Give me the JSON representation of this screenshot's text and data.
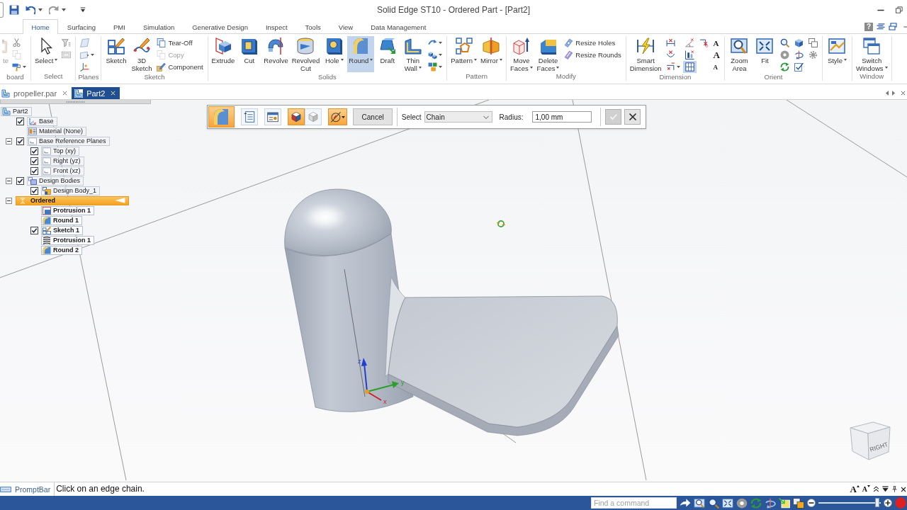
{
  "window": {
    "title": "Solid Edge ST10 - Ordered Part - [Part2]"
  },
  "ribbon_tabs": [
    {
      "label": "Home",
      "selected": true
    },
    {
      "label": "Surfacing",
      "selected": false
    },
    {
      "label": "PMI",
      "selected": false
    },
    {
      "label": "Simulation",
      "selected": false
    },
    {
      "label": "Generative Design",
      "selected": false
    },
    {
      "label": "Inspect",
      "selected": false
    },
    {
      "label": "Tools",
      "selected": false
    },
    {
      "label": "View",
      "selected": false
    },
    {
      "label": "Data Management",
      "selected": false
    }
  ],
  "help_button": {
    "label": "?"
  },
  "ribbon": [
    {
      "label": "board",
      "items": [
        {
          "kind": "large",
          "label": "te",
          "selected": false,
          "disabled": true
        },
        {
          "kind": "column",
          "buttons": [
            {
              "selected": false
            },
            {
              "selected": false,
              "disabled": true
            },
            {
              "selected": false,
              "dropdown": true
            }
          ]
        }
      ]
    },
    {
      "label": "Select",
      "items": [
        {
          "kind": "large",
          "label": "Select",
          "selected": false,
          "dropdown": true
        },
        {
          "kind": "column",
          "buttons": [
            {
              "selected": false
            },
            {
              "selected": false
            }
          ]
        }
      ]
    },
    {
      "label": "Planes",
      "items": [
        {
          "kind": "column",
          "buttons": [
            {
              "selected": false
            },
            {
              "selected": false,
              "dropdown": true
            },
            {
              "selected": false
            }
          ]
        }
      ]
    },
    {
      "label": "Sketch",
      "items": [
        {
          "kind": "large",
          "label": "Sketch",
          "selected": false
        },
        {
          "kind": "large",
          "label": "3D Sketch",
          "selected": false
        },
        {
          "kind": "column",
          "buttons": [
            {
              "label": "Tear-Off",
              "selected": false
            },
            {
              "label": "Copy",
              "selected": false,
              "disabled": true
            },
            {
              "label": "Component",
              "selected": false
            }
          ]
        }
      ]
    },
    {
      "label": "Solids",
      "items": [
        {
          "kind": "large",
          "label": "Extrude",
          "selected": false
        },
        {
          "kind": "large",
          "label": "Cut",
          "selected": false
        },
        {
          "kind": "large",
          "label": "Revolve",
          "selected": false
        },
        {
          "kind": "large",
          "label": "Revolved Cut",
          "selected": false
        },
        {
          "kind": "large",
          "label": "Hole",
          "selected": false,
          "dropdown": true
        },
        {
          "kind": "large",
          "label": "Round",
          "selected": true,
          "dropdown": true
        },
        {
          "kind": "large",
          "label": "Draft",
          "selected": false
        },
        {
          "kind": "large",
          "label": "Thin Wall",
          "selected": false,
          "dropdown": true
        },
        {
          "kind": "column",
          "buttons": [
            {
              "selected": false,
              "dropdown": true
            },
            {
              "selected": false,
              "dropdown": true
            },
            {
              "selected": false,
              "dropdown": true
            }
          ]
        }
      ]
    },
    {
      "label": "Pattern",
      "items": [
        {
          "kind": "large",
          "label": "Pattern",
          "selected": false,
          "dropdown": true
        },
        {
          "kind": "large",
          "label": "Mirror",
          "selected": false,
          "dropdown": true
        }
      ]
    },
    {
      "label": "Modify",
      "items": [
        {
          "kind": "large",
          "label": "Move Faces",
          "selected": false,
          "dropdown": true
        },
        {
          "kind": "large",
          "label": "Delete Faces",
          "selected": false,
          "dropdown": true
        },
        {
          "kind": "column",
          "buttons": [
            {
              "label": "Resize Holes",
              "selected": false
            },
            {
              "label": "Resize Rounds",
              "selected": false
            }
          ]
        }
      ]
    },
    {
      "label": "Dimension",
      "items": [
        {
          "kind": "large",
          "label": "Smart Dimension",
          "selected": false
        },
        {
          "kind": "column",
          "buttons": [
            {
              "selected": false
            },
            {
              "selected": false
            },
            {
              "selected": false,
              "dropdown": true
            }
          ]
        },
        {
          "kind": "column",
          "buttons": [
            {
              "selected": false
            },
            {
              "selected": false
            },
            {
              "selected": true
            }
          ]
        },
        {
          "kind": "column",
          "buttons": [
            {
              "selected": false
            }
          ]
        },
        {
          "kind": "column",
          "buttons": [
            {
              "label": "A",
              "selected": false
            },
            {
              "label": "A",
              "selected": false
            },
            {
              "label": "A",
              "selected": false
            }
          ]
        }
      ]
    },
    {
      "label": "Orient",
      "items": [
        {
          "kind": "large",
          "label": "Zoom Area",
          "selected": false
        },
        {
          "kind": "large",
          "label": "Fit",
          "selected": false
        },
        {
          "kind": "column",
          "buttons": [
            {
              "selected": false
            },
            {
              "selected": false
            },
            {
              "selected": false
            }
          ]
        },
        {
          "kind": "column",
          "buttons": [
            {
              "selected": false
            },
            {
              "selected": false
            },
            {
              "selected": false
            }
          ]
        },
        {
          "kind": "column",
          "buttons": [
            {
              "selected": false
            },
            {
              "selected": false
            }
          ]
        }
      ]
    },
    {
      "items": [
        {
          "kind": "large",
          "label": "Style",
          "selected": false,
          "dropdown": true
        }
      ]
    },
    {
      "label": "Window",
      "items": [
        {
          "kind": "large",
          "label": "Switch Windows",
          "selected": false,
          "dropdown": true
        }
      ]
    }
  ],
  "documents": [
    {
      "label": "propeller.par",
      "selected": false
    },
    {
      "label": "Part2",
      "selected": true
    }
  ],
  "pathfinder": {
    "items": [
      {
        "label": "Part2",
        "kind": "node",
        "children": [
          {
            "label": "Base",
            "kind": "node",
            "checked": true
          },
          {
            "label": "Material (None)",
            "kind": "node"
          },
          {
            "label": "Base Reference Planes",
            "kind": "node",
            "checked": true,
            "expanded": true,
            "children": [
              {
                "label": "Top (xy)",
                "kind": "node",
                "checked": true
              },
              {
                "label": "Right (yz)",
                "kind": "node",
                "checked": true
              },
              {
                "label": "Front (xz)",
                "kind": "node",
                "checked": true
              }
            ]
          },
          {
            "label": "Design Bodies",
            "kind": "node",
            "checked": true,
            "expanded": true,
            "children": [
              {
                "label": "Design Body_1",
                "kind": "node",
                "checked": true
              }
            ]
          },
          {
            "label": "Ordered",
            "kind": "section",
            "expanded": true,
            "children": [
              {
                "label": "Protrusion 1",
                "kind": "feature"
              },
              {
                "label": "Round 1",
                "kind": "feature"
              },
              {
                "label": "Sketch 1",
                "kind": "feature",
                "checked": true
              },
              {
                "label": "Protrusion 1",
                "kind": "feature"
              },
              {
                "label": "Round 2",
                "kind": "feature"
              }
            ]
          }
        ]
      }
    ]
  },
  "command_bar": {
    "tools": [
      {
        "kind": "step",
        "selected": true
      },
      {
        "kind": "option",
        "selected": false
      },
      {
        "kind": "option",
        "selected": false
      },
      {
        "kind": "option",
        "selected": true
      },
      {
        "kind": "option",
        "selected": false
      },
      {
        "kind": "option",
        "selected": true,
        "dropdown": true
      }
    ],
    "cancel": "Cancel",
    "select_label": "Select",
    "select_value": "Chain",
    "radius_label": "Radius:",
    "radius_value": "1,00 mm",
    "finish_buttons": [
      {
        "disabled": true
      },
      {
        "disabled": false
      }
    ]
  },
  "viewport": {
    "triad_labels": [
      "z",
      "y",
      "x"
    ],
    "view_cube_label": "RIGHT"
  },
  "prompt_bar": {
    "title": "PromptBar",
    "message": "Click on an edge chain.",
    "font_buttons": [
      {
        "label": "A"
      },
      {
        "label": "A"
      }
    ]
  },
  "status_bar": {
    "search": {
      "placeholder": "Find a command"
    },
    "zoom_slider": {
      "level": 0.95
    }
  }
}
